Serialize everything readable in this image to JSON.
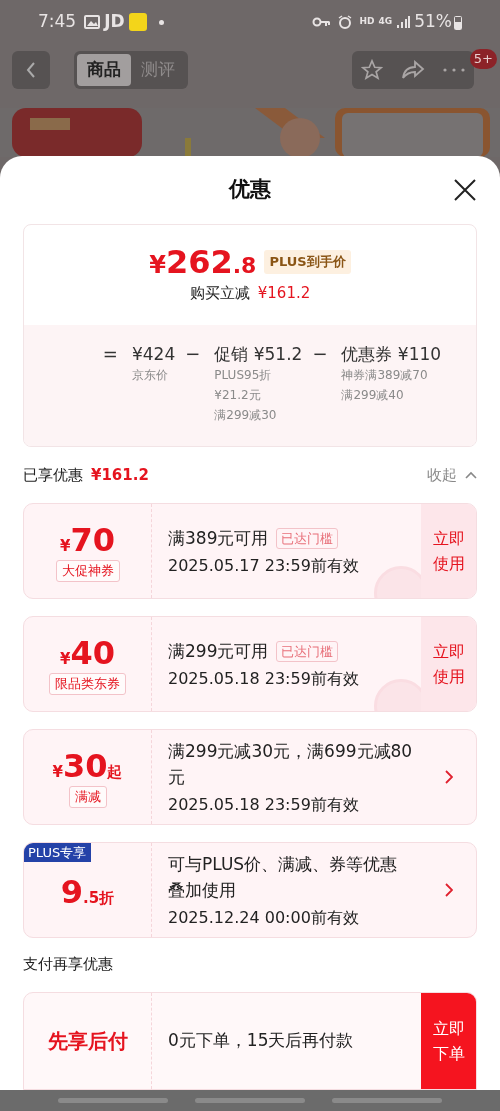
{
  "status_bar": {
    "time": "7:45",
    "app": "JD",
    "hd": "HD",
    "network": "4G",
    "battery": "51%"
  },
  "nav": {
    "tabs": [
      {
        "label": "商品",
        "selected": true
      },
      {
        "label": "测评",
        "selected": false
      }
    ],
    "badge": "5+"
  },
  "sheet": {
    "title": "优惠",
    "summary": {
      "price_symbol": "¥",
      "price_int": "262",
      "price_dec": ".8",
      "price_tag": "PLUS到手价",
      "saving_label": "购买立减",
      "saving": "¥161.2",
      "terms": [
        {
          "op": "=",
          "value": "¥424",
          "notes": [
            "京东价"
          ]
        },
        {
          "op": "−",
          "value": "促销 ¥51.2",
          "notes": [
            "PLUS95折",
            "¥21.2元",
            "满299减30"
          ]
        },
        {
          "op": "−",
          "value": "优惠券 ¥110",
          "notes": [
            "神券满389减70",
            "满299减40"
          ]
        }
      ]
    },
    "enjoyed": {
      "label": "已享优惠",
      "amount": "¥161.2",
      "toggle": "收起"
    },
    "offers": [
      {
        "kind": "coupon",
        "symbol": "¥",
        "amount": "70",
        "tag": "大促神券",
        "condition": "满389元可用",
        "threshold": "已达门槛",
        "validity": "2025.05.17 23:59前有效",
        "action": "立即使用",
        "claimed": true
      },
      {
        "kind": "coupon",
        "symbol": "¥",
        "amount": "40",
        "tag": "限品类东券",
        "condition": "满299元可用",
        "threshold": "已达门槛",
        "validity": "2025.05.18 23:59前有效",
        "action": "立即使用",
        "claimed": true
      },
      {
        "kind": "discount",
        "symbol": "¥",
        "amount": "30",
        "suffix": "起",
        "tag": "满减",
        "condition": "满299元减30元，满699元减80元",
        "validity": "2025.05.18 23:59前有效"
      },
      {
        "kind": "plus",
        "badge": "PLUS专享",
        "amount": "9",
        "suffix": ".5折",
        "condition": "可与PLUS价、满减、券等优惠叠加使用",
        "validity": "2025.12.24 00:00前有效"
      }
    ],
    "pay_section": "支付再享优惠",
    "pay": {
      "title": "先享后付",
      "text": "0元下单，15天后再付款",
      "action": "立即下单"
    }
  }
}
